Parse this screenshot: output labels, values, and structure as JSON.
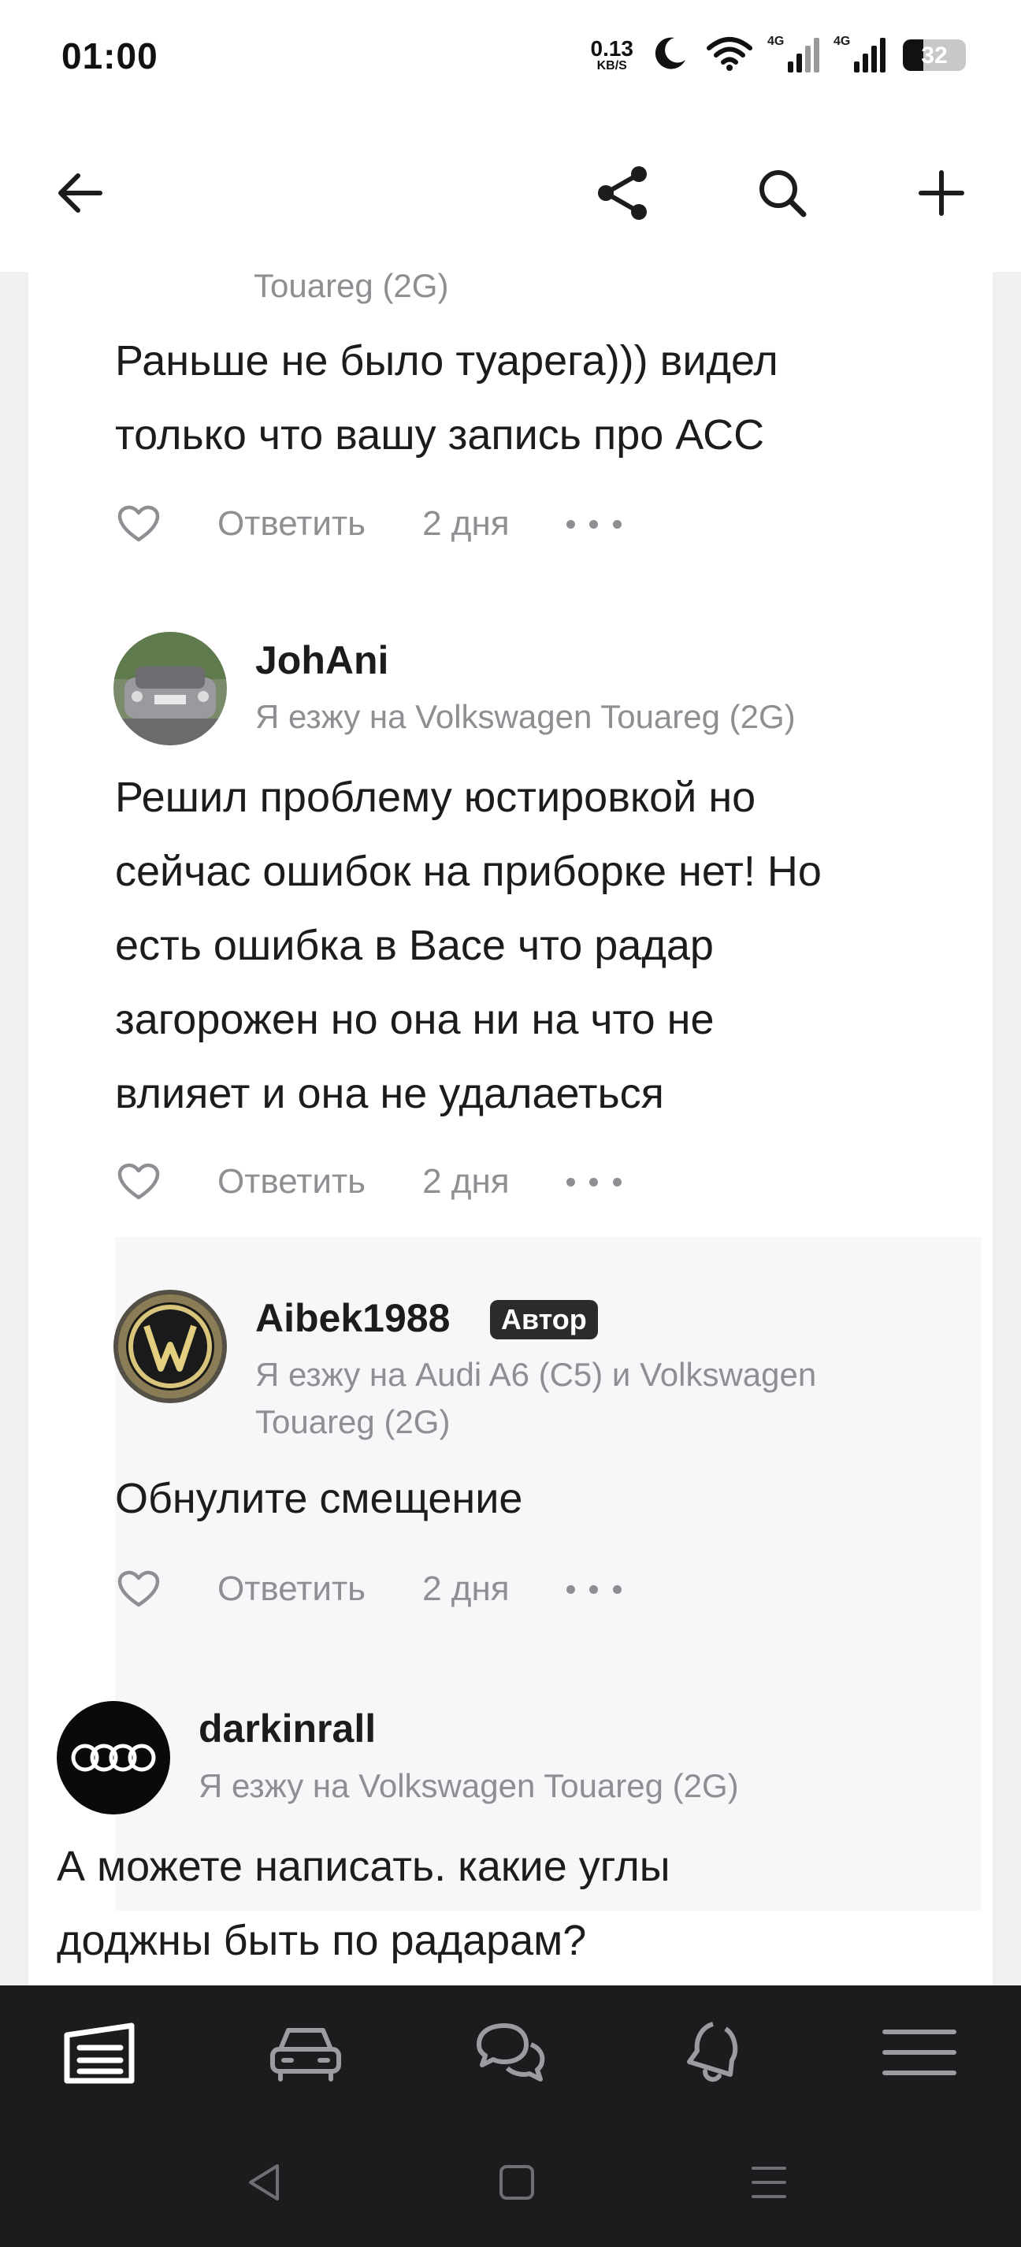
{
  "status_bar": {
    "time": "01:00",
    "net_speed_value": "0.13",
    "net_speed_unit": "KB/S",
    "network_1": "4G",
    "network_2": "4G",
    "battery_level": "32",
    "icons": [
      "moon-icon",
      "wifi-icon",
      "signal-icon",
      "signal-icon",
      "battery-icon"
    ]
  },
  "app_bar": {
    "icons": [
      "back-arrow-icon",
      "share-icon",
      "search-icon",
      "plus-icon"
    ]
  },
  "comments": [
    {
      "meta_continuation": "Touareg (2G)",
      "text_lines": [
        "Раньше не было туарега))) видел",
        "только что вашу запись про АСС"
      ],
      "reply_label": "Ответить",
      "time": "2 дня"
    },
    {
      "username": "JohAni",
      "drives_line": "Я езжу на Volkswagen Touareg (2G)",
      "text_lines": [
        "Решил проблему юстировкой но",
        "сейчас ошибок на приборке нет! Но",
        "есть ошибка в Васе что радар",
        "загорожен но она ни на что не",
        "влияет и она не удалаеться"
      ],
      "reply_label": "Ответить",
      "time": "2 дня"
    },
    {
      "username": "Aibek1988",
      "badge": "Автор",
      "drives_line_1": "Я езжу на Audi A6 (C5) и Volkswagen",
      "drives_line_2": "Touareg (2G)",
      "text_lines": [
        "Обнулите смещение"
      ],
      "reply_label": "Ответить",
      "time": "2 дня"
    },
    {
      "username": "darkinrall",
      "drives_line": "Я езжу на Volkswagen Touareg (2G)",
      "text_lines": [
        "А можете написать. какие углы",
        "доджны быть по радарам?"
      ]
    }
  ],
  "bottom_nav": {
    "items": [
      "garage-icon",
      "car-icon",
      "chat-icon",
      "bell-icon",
      "menu-icon"
    ]
  },
  "system_nav": {
    "items": [
      "back-triangle-icon",
      "home-square-icon",
      "recents-icon"
    ]
  },
  "colors": {
    "background": "#f0f0f3",
    "card": "#ffffff",
    "text_primary": "#1c1c1e",
    "text_secondary": "#8e8e93",
    "nav_bar": "#1c1c1e",
    "badge_bg": "#2b2b2e"
  }
}
